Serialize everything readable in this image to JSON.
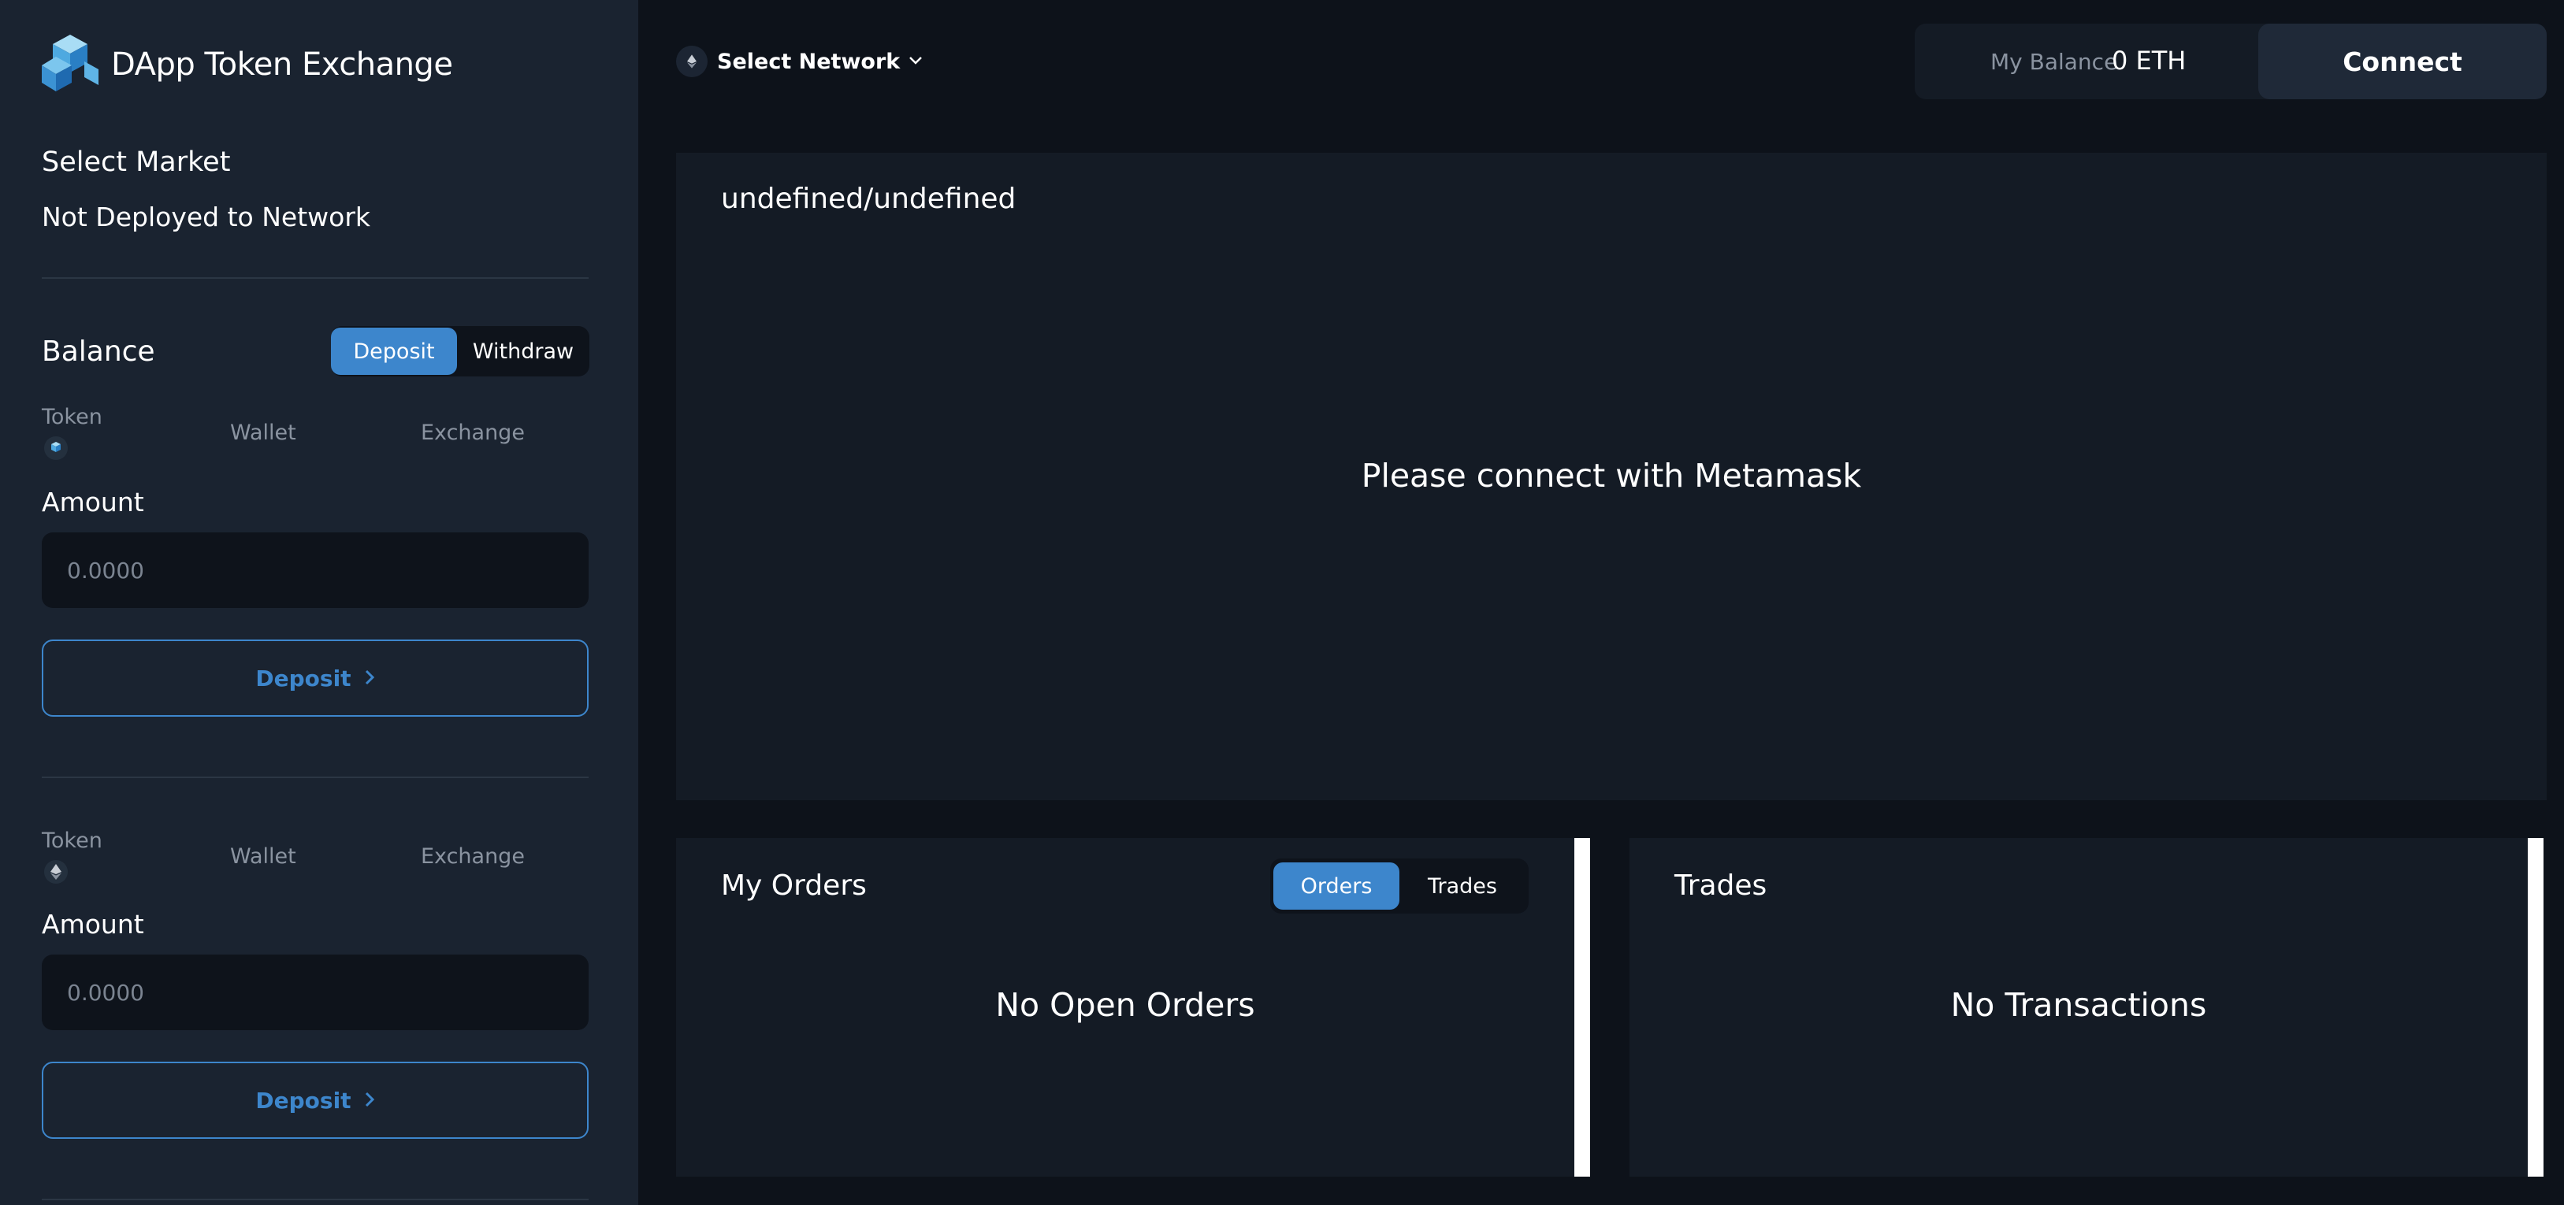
{
  "brand": {
    "title": "DApp Token Exchange",
    "logo": "cube-logo-icon"
  },
  "sidebar": {
    "market_heading": "Select Market",
    "market_value": "Not Deployed to Network",
    "balance_heading": "Balance",
    "toggle": {
      "deposit": "Deposit",
      "withdraw": "Withdraw",
      "active": "Deposit"
    },
    "sections": [
      {
        "col_token": "Token",
        "col_wallet": "Wallet",
        "col_exchange": "Exchange",
        "token_icon": "dapp-token-icon",
        "amount_label": "Amount",
        "amount_placeholder": "0.0000",
        "button_label": "Deposit"
      },
      {
        "col_token": "Token",
        "col_wallet": "Wallet",
        "col_exchange": "Exchange",
        "token_icon": "eth-icon",
        "amount_label": "Amount",
        "amount_placeholder": "0.0000",
        "button_label": "Deposit"
      }
    ]
  },
  "topbar": {
    "network_label": "Select Network",
    "balance_label": "My Balance",
    "balance_value": "0 ETH",
    "connect_label": "Connect"
  },
  "chart_panel": {
    "title": "undefined/undefined",
    "message": "Please connect with Metamask"
  },
  "orders_panel": {
    "title": "My Orders",
    "tabs": {
      "orders": "Orders",
      "trades": "Trades",
      "active": "Orders"
    },
    "message": "No Open Orders"
  },
  "trades_panel": {
    "title": "Trades",
    "message": "No Transactions"
  },
  "colors": {
    "accent": "#3d86cc",
    "sidebar_bg": "#1a2330",
    "panel_bg": "#141b25",
    "page_bg": "#0d121a"
  }
}
